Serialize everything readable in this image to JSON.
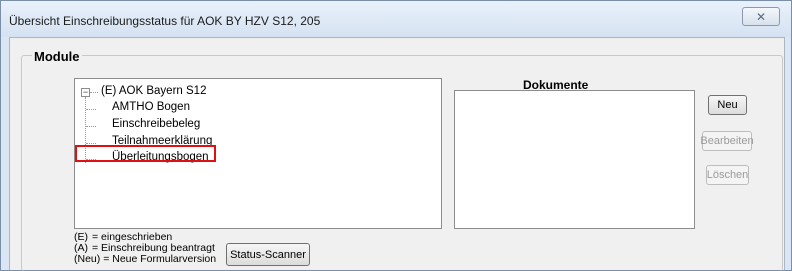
{
  "window": {
    "title": "Übersicht Einschreibungsstatus für AOK BY HZV S12, 205",
    "close_glyph": "✕"
  },
  "group": {
    "label": "Module"
  },
  "tree": {
    "root": {
      "expander": "−",
      "label": "(E) AOK Bayern S12"
    },
    "children": [
      "AMTHO Bogen",
      "Einschreibebeleg",
      "Teilnahmeerklärung",
      "Überleitungsbogen"
    ]
  },
  "documents": {
    "header": "Dokumente"
  },
  "buttons": {
    "neu": "Neu",
    "bearbeiten": "Bearbeiten",
    "loeschen": "Löschen",
    "status_scanner": "Status-Scanner"
  },
  "legend": [
    {
      "key": "(E)",
      "text": "= eingeschrieben"
    },
    {
      "key": "(A)",
      "text": "= Einschreibung beantragt"
    },
    {
      "key": "(Neu)",
      "text": "= Neue Formularversion"
    }
  ],
  "colors": {
    "highlight": "#e01010",
    "window_frame": "#dbe6f4"
  }
}
